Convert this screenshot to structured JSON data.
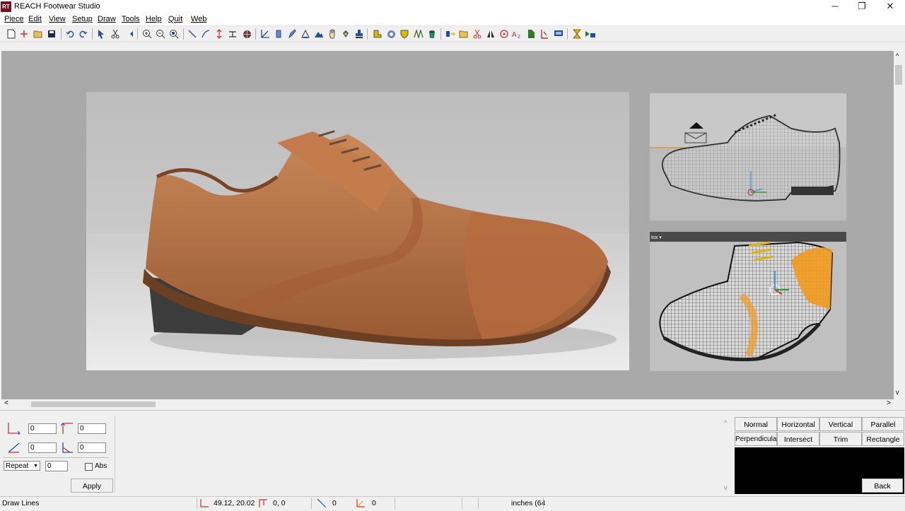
{
  "window": {
    "title": "REACH Footwear Studio",
    "logo": "RT",
    "minimize": "─",
    "restore": "❐",
    "close": "✕"
  },
  "menu": [
    {
      "label": "Piece"
    },
    {
      "label": "Edit"
    },
    {
      "label": "View"
    },
    {
      "label": "Setup"
    },
    {
      "label": "Draw"
    },
    {
      "label": "Tools"
    },
    {
      "label": "Help"
    },
    {
      "label": "Quit"
    },
    {
      "label": "Web"
    }
  ],
  "toolbar": {
    "icons": [
      "new-file-icon",
      "add-icon",
      "open-folder-icon",
      "save-icon",
      "undo-icon",
      "redo-icon",
      "select-arrow-icon",
      "cut-icon",
      "pointer-tool-icon",
      "zoom-in-icon",
      "zoom-out-icon",
      "zoom-fit-icon",
      "line-tool-icon",
      "curve-tool-icon",
      "vertical-arrow-icon",
      "measure-icon",
      "globe-icon",
      "angle-icon",
      "shape-tool-icon",
      "pen-icon",
      "stitch-icon",
      "mountain-icon",
      "hand-icon",
      "fill-icon",
      "stamp-icon",
      "piece-icon",
      "target-icon",
      "shield-icon",
      "grid-icon",
      "bucket-icon",
      "move-icon",
      "open-folder-icon",
      "scissors-icon",
      "rotate-icon",
      "text-size-icon",
      "bookmark-icon",
      "trim-tool-icon",
      "screen-icon",
      "hourglass-icon",
      "grade-icon"
    ],
    "accent_blue": "#1f4fa8",
    "accent_yellow": "#e2b400"
  },
  "viewport": {
    "background": "#a9a9a9",
    "scroll_left": "<",
    "scroll_right": ">",
    "scroll_up": "^",
    "scroll_down": "v"
  },
  "views": {
    "wire2_label": "tox ▾"
  },
  "panel": {
    "fields": {
      "f1": "0",
      "f2": "0",
      "f3": "0",
      "f4": "0",
      "repeat_count": "0"
    },
    "repeat_select": "Repeat",
    "abs_label": "Abs",
    "apply_label": "Apply",
    "buttons": {
      "normal": "Normal",
      "horizontal": "Horizontal",
      "vertical": "Vertical",
      "parallel": "Parallel",
      "perpendicular": "Perpendicular",
      "intersect": "Intersect",
      "trim": "Trim",
      "rectangle": "Rectangle"
    },
    "back_label": "Back"
  },
  "status": {
    "mode": "Draw Lines",
    "coords": "49.12, 20.02",
    "offset": "0, 0",
    "length": "0",
    "angle": "0",
    "units": "inches (64"
  },
  "colors": {
    "leather": "#b86c3e",
    "mesh_orange": "#f29a1c",
    "logo_bg": "#7a1020"
  }
}
